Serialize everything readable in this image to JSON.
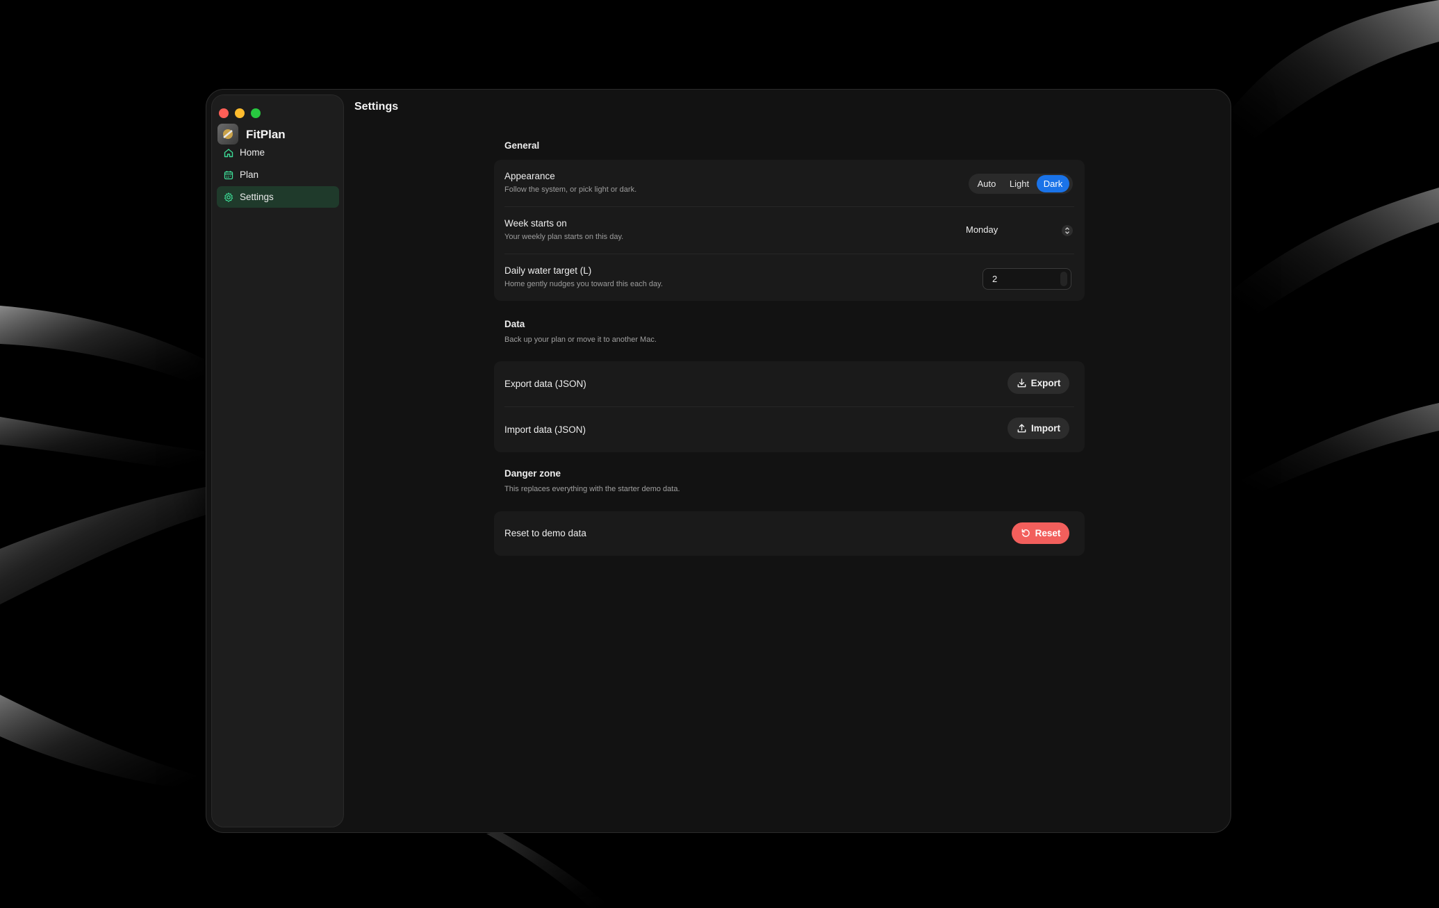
{
  "app": {
    "name": "FitPlan"
  },
  "page": {
    "title": "Settings"
  },
  "sidebar": {
    "items": [
      {
        "label": "Home",
        "icon": "home-icon",
        "active": false
      },
      {
        "label": "Plan",
        "icon": "calendar-icon",
        "active": false
      },
      {
        "label": "Settings",
        "icon": "gear-icon",
        "active": true
      }
    ]
  },
  "general": {
    "heading": "General",
    "appearance": {
      "label": "Appearance",
      "description": "Follow the system, or pick light or dark.",
      "options": [
        "Auto",
        "Light",
        "Dark"
      ],
      "selected": "Dark"
    },
    "week_start": {
      "label": "Week starts on",
      "description": "Your weekly plan starts on this day.",
      "value": "Monday"
    },
    "water_target": {
      "label": "Daily water target (L)",
      "description": "Home gently nudges you toward this each day.",
      "value": "2"
    }
  },
  "data": {
    "heading": "Data",
    "description": "Back up your plan or move it to another Mac.",
    "export": {
      "label": "Export data (JSON)",
      "button": "Export"
    },
    "import": {
      "label": "Import data (JSON)",
      "button": "Import"
    }
  },
  "danger": {
    "heading": "Danger zone",
    "description": "This replaces everything with the starter demo data.",
    "reset": {
      "label": "Reset to demo data",
      "button": "Reset"
    }
  },
  "colors": {
    "accent": "#1a73e8",
    "danger": "#f25f5c",
    "sidebar_active": "#1f3a2b",
    "icon_green": "#3ddc97"
  }
}
